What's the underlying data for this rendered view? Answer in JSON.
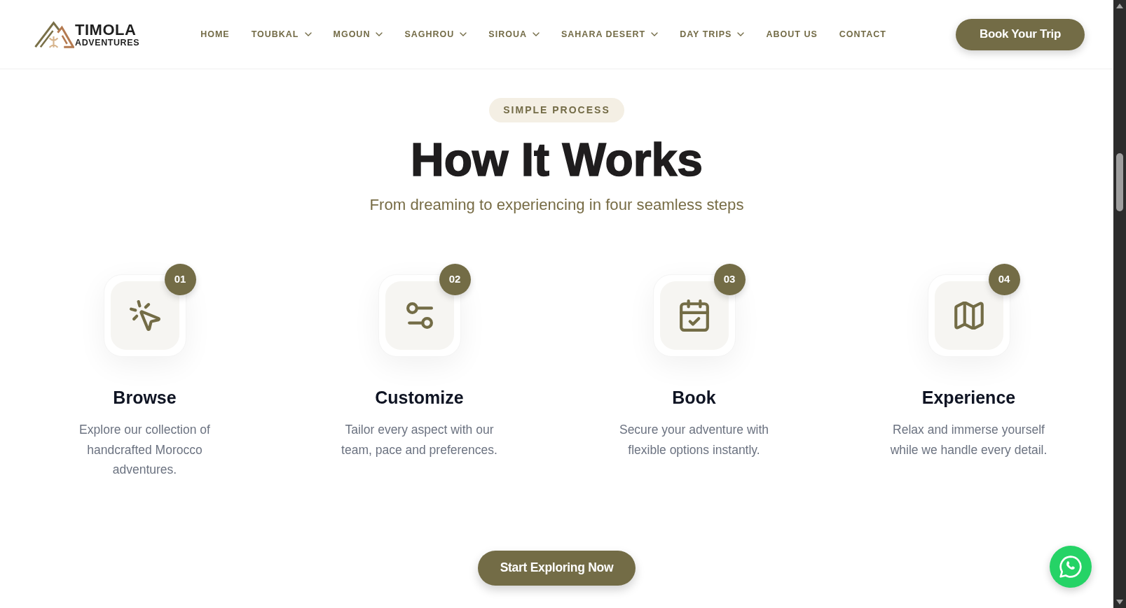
{
  "header": {
    "logo": {
      "name": "TIMOLA",
      "tagline": "ADVENTURES"
    },
    "nav": [
      {
        "label": "HOME",
        "has_dropdown": false
      },
      {
        "label": "TOUBKAL",
        "has_dropdown": true
      },
      {
        "label": "MGOUN",
        "has_dropdown": true
      },
      {
        "label": "SAGHROU",
        "has_dropdown": true
      },
      {
        "label": "SIROUA",
        "has_dropdown": true
      },
      {
        "label": "SAHARA DESERT",
        "has_dropdown": true
      },
      {
        "label": "DAY TRIPS",
        "has_dropdown": true
      },
      {
        "label": "ABOUT US",
        "has_dropdown": false
      },
      {
        "label": "CONTACT",
        "has_dropdown": false
      }
    ],
    "cta": "Book Your Trip"
  },
  "how_it_works": {
    "eyebrow": "SIMPLE PROCESS",
    "title": "How It Works",
    "subtitle": "From dreaming to experiencing in four seamless steps",
    "steps": [
      {
        "number": "01",
        "title": "Browse",
        "description": "Explore our collection of handcrafted Morocco adventures."
      },
      {
        "number": "02",
        "title": "Customize",
        "description": "Tailor every aspect with our team, pace and preferences."
      },
      {
        "number": "03",
        "title": "Book",
        "description": "Secure your adventure with flexible options instantly."
      },
      {
        "number": "04",
        "title": "Experience",
        "description": "Relax and immerse yourself while we handle every detail."
      }
    ],
    "cta": "Start Exploring Now"
  }
}
